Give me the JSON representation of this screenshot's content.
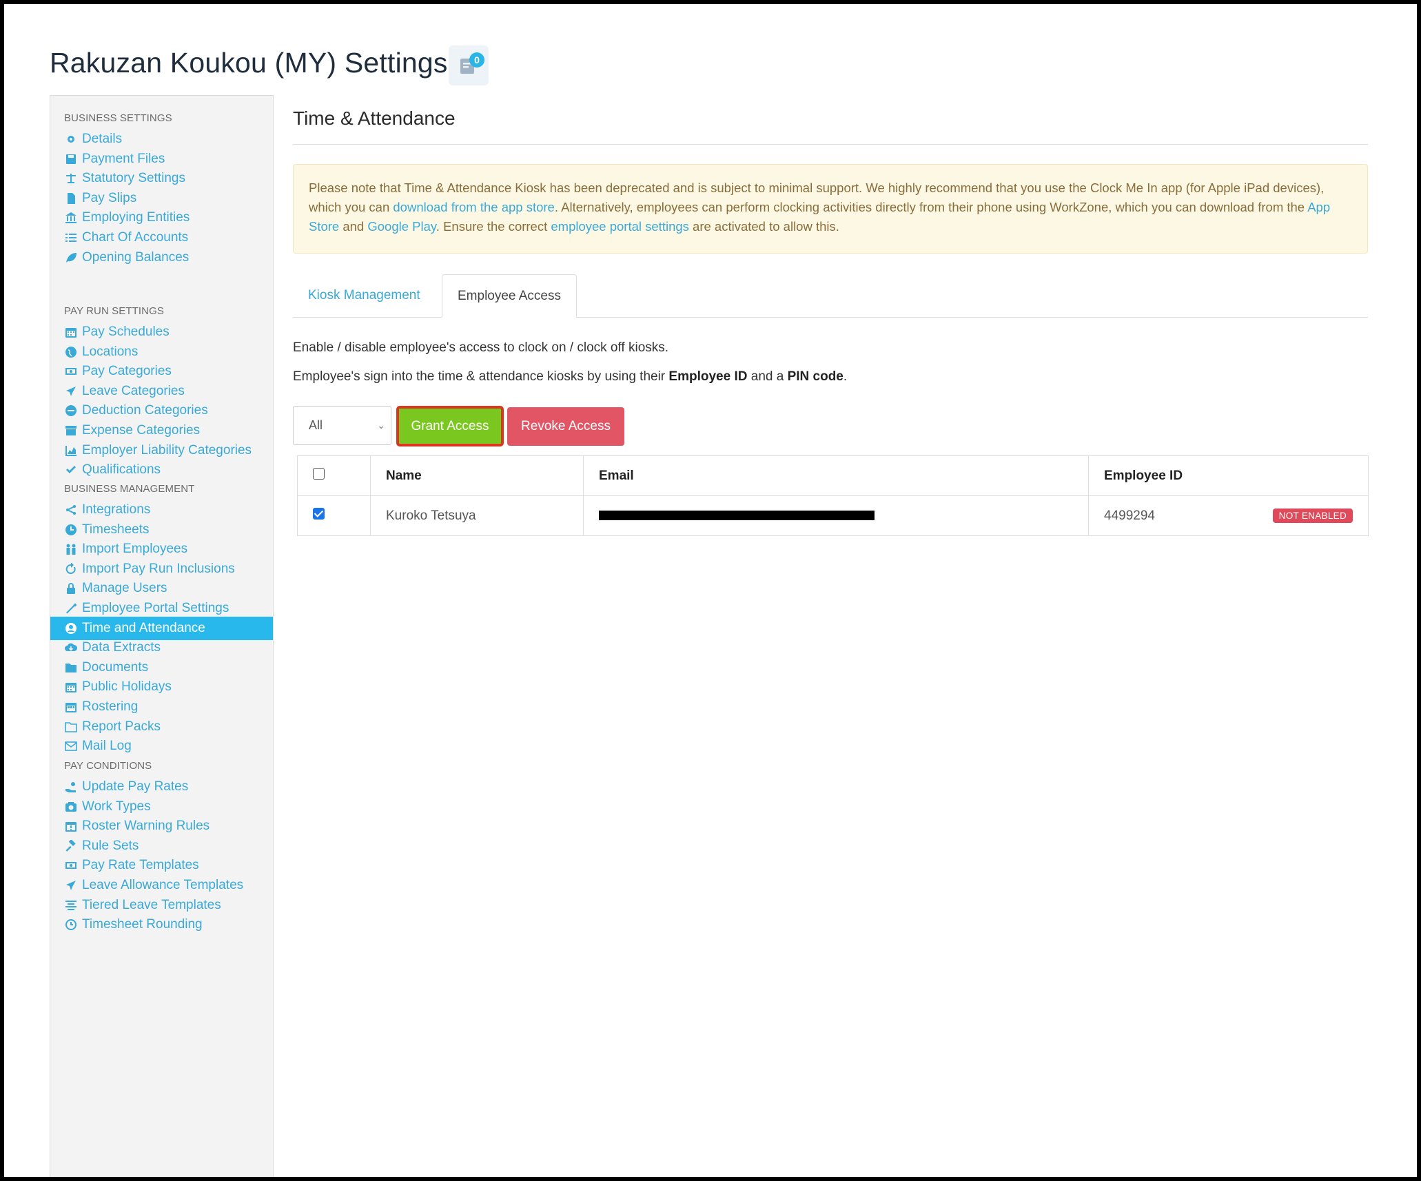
{
  "header": {
    "title": "Rakuzan Koukou (MY) Settings",
    "notification_count": "0"
  },
  "sidebar": {
    "sections": [
      {
        "label": "BUSINESS SETTINGS",
        "items": [
          {
            "label": "Details",
            "icon": "gear-icon"
          },
          {
            "label": "Payment Files",
            "icon": "floppy-icon"
          },
          {
            "label": "Statutory Settings",
            "icon": "scale-icon"
          },
          {
            "label": "Pay Slips",
            "icon": "file-icon"
          },
          {
            "label": "Employing Entities",
            "icon": "bank-icon"
          },
          {
            "label": "Chart Of Accounts",
            "icon": "list-icon"
          },
          {
            "label": "Opening Balances",
            "icon": "leaf-icon"
          }
        ]
      },
      {
        "label": "PAY RUN SETTINGS",
        "items": [
          {
            "label": "Pay Schedules",
            "icon": "calendar-icon"
          },
          {
            "label": "Locations",
            "icon": "globe-icon"
          },
          {
            "label": "Pay Categories",
            "icon": "money-icon"
          },
          {
            "label": "Leave Categories",
            "icon": "plane-icon"
          },
          {
            "label": "Deduction Categories",
            "icon": "minus-circle-icon"
          },
          {
            "label": "Expense Categories",
            "icon": "archive-icon"
          },
          {
            "label": "Employer Liability Categories",
            "icon": "area-chart-icon"
          },
          {
            "label": "Qualifications",
            "icon": "check-icon"
          }
        ]
      },
      {
        "label": "BUSINESS MANAGEMENT",
        "items": [
          {
            "label": "Integrations",
            "icon": "integration-icon"
          },
          {
            "label": "Timesheets",
            "icon": "clock-icon"
          },
          {
            "label": "Import Employees",
            "icon": "users-icon"
          },
          {
            "label": "Import Pay Run Inclusions",
            "icon": "refresh-icon"
          },
          {
            "label": "Manage Users",
            "icon": "lock-icon"
          },
          {
            "label": "Employee Portal Settings",
            "icon": "wand-icon"
          },
          {
            "label": "Time and Attendance",
            "icon": "user-circle-icon",
            "active": true
          },
          {
            "label": "Data Extracts",
            "icon": "cloud-download-icon"
          },
          {
            "label": "Documents",
            "icon": "folder-icon"
          },
          {
            "label": "Public Holidays",
            "icon": "calendar-icon"
          },
          {
            "label": "Rostering",
            "icon": "calendar-grid-icon"
          },
          {
            "label": "Report Packs",
            "icon": "folder-open-icon"
          },
          {
            "label": "Mail Log",
            "icon": "envelope-icon"
          }
        ]
      },
      {
        "label": "PAY CONDITIONS",
        "items": [
          {
            "label": "Update Pay Rates",
            "icon": "hand-money-icon"
          },
          {
            "label": "Work Types",
            "icon": "camera-icon"
          },
          {
            "label": "Roster Warning Rules",
            "icon": "calendar-alert-icon"
          },
          {
            "label": "Rule Sets",
            "icon": "gavel-icon"
          },
          {
            "label": "Pay Rate Templates",
            "icon": "money-icon"
          },
          {
            "label": "Leave Allowance Templates",
            "icon": "plane-icon"
          },
          {
            "label": "Tiered Leave Templates",
            "icon": "align-icon"
          },
          {
            "label": "Timesheet Rounding",
            "icon": "clock-outline-icon"
          }
        ]
      }
    ]
  },
  "main": {
    "title": "Time & Attendance",
    "alert": {
      "p1": "Please note that Time & Attendance Kiosk has been deprecated and is subject to minimal support. We highly recommend that you use the Clock Me In app (for Apple iPad devices), which you can ",
      "link1": "download from the app store",
      "p2": ". Alternatively, employees can perform clocking activities directly from their phone using WorkZone, which you can download from the ",
      "link2": "App Store",
      "p3": " and ",
      "link3": "Google Play",
      "p4": ". Ensure the correct ",
      "link4": "employee portal settings",
      "p5": " are activated to allow this."
    },
    "tabs": [
      {
        "label": "Kiosk Management"
      },
      {
        "label": "Employee Access"
      }
    ],
    "desc1": "Enable / disable employee's access to clock on / clock off kiosks.",
    "desc2_a": "Employee's sign into the time & attendance kiosks by using their ",
    "desc2_b": "Employee ID",
    "desc2_c": " and a ",
    "desc2_d": "PIN code",
    "desc2_e": ".",
    "filter": {
      "selected": "All"
    },
    "grant_label": "Grant Access",
    "revoke_label": "Revoke Access",
    "table": {
      "headers": {
        "name": "Name",
        "email": "Email",
        "employee_id": "Employee ID"
      },
      "rows": [
        {
          "name": "Kuroko Tetsuya",
          "email_redacted": true,
          "employee_id": "4499294",
          "status": "NOT ENABLED",
          "checked": true
        }
      ]
    }
  },
  "colors": {
    "accent": "#39a9d8",
    "active_bg": "#29b8ec",
    "grant": "#7ac720",
    "revoke": "#e25565",
    "badge": "#e0495a"
  }
}
